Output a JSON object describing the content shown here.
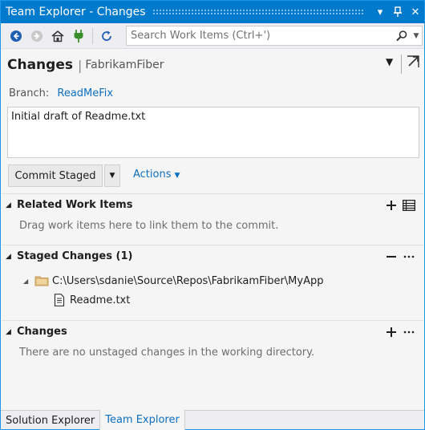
{
  "window": {
    "title": "Team Explorer - Changes",
    "accent_color": "#007acc"
  },
  "titlebar_buttons": {
    "dropdown": "▾",
    "pin": "pin-icon",
    "close": "✕"
  },
  "toolbar": {
    "search_placeholder": "Search Work Items (Ctrl+')"
  },
  "header": {
    "title": "Changes",
    "separator": "|",
    "project": "FabrikamFiber"
  },
  "branch": {
    "label": "Branch:",
    "name": "ReadMeFix"
  },
  "commit_message": "Initial draft of Readme.txt",
  "commit": {
    "button_label": "Commit Staged",
    "actions_label": "Actions"
  },
  "sections": {
    "related": {
      "title": "Related Work Items",
      "hint": "Drag work items here to link them to the commit."
    },
    "staged": {
      "title": "Staged Changes (1)",
      "folder_path": "C:\\Users\\sdanie\\Source\\Repos\\FabrikamFiber\\MyApp",
      "file": "Readme.txt"
    },
    "changes": {
      "title": "Changes",
      "hint": "There are no unstaged changes in the working directory."
    }
  },
  "tabs": [
    {
      "label": "Solution Explorer",
      "active": false
    },
    {
      "label": "Team Explorer",
      "active": true
    }
  ]
}
